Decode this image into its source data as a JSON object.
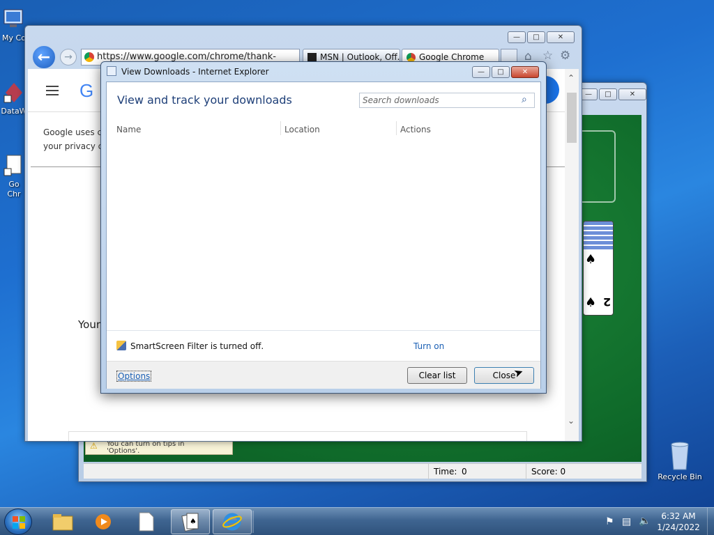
{
  "desktop": {
    "icons": [
      {
        "label": "My Co"
      },
      {
        "label": "DataW"
      },
      {
        "label": "Go\nChr"
      },
      {
        "label": "Recycle Bin"
      }
    ]
  },
  "solitaire": {
    "status_time_label": "Time:",
    "status_time_value": "0",
    "status_score": "Score: 0",
    "tip_line1": "You can turn on tips in",
    "tip_line2": "'Options'."
  },
  "browser": {
    "address": "https://www.google.com/chrome/thank-",
    "tabs": [
      {
        "label": "MSN | Outlook, Off..."
      },
      {
        "label": "Google Chrome"
      }
    ],
    "page": {
      "logo_partial": "G",
      "cookie_text_line1": "Google uses co",
      "cookie_text_line2": "your privacy co",
      "your_text": "Your"
    }
  },
  "dialog": {
    "title": "View Downloads - Internet Explorer",
    "heading": "View and track your downloads",
    "search_placeholder": "Search downloads",
    "columns": [
      "Name",
      "Location",
      "Actions"
    ],
    "smartscreen_text": "SmartScreen Filter is turned off.",
    "turn_on": "Turn on",
    "options": "Options",
    "clear_list": "Clear list",
    "close": "Close"
  },
  "taskbar": {
    "time": "6:32 AM",
    "date": "1/24/2022"
  },
  "colors": {
    "link": "#1a5fb4",
    "heading": "#1e3f78",
    "felt": "#0f6a2a"
  }
}
